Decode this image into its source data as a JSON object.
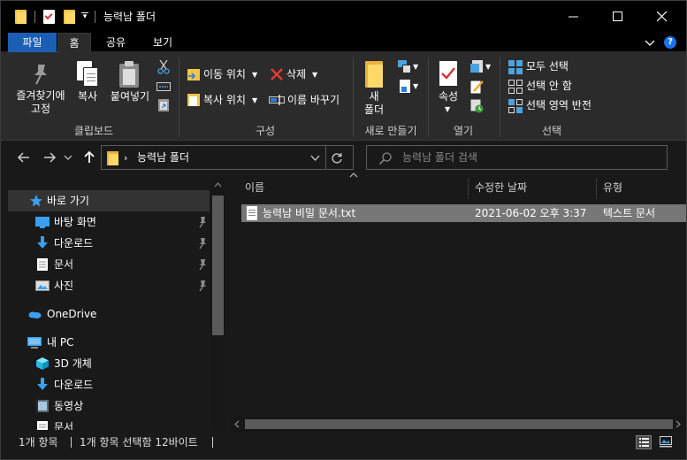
{
  "window": {
    "title": "능력남 폴더"
  },
  "tabs": {
    "file": "파일",
    "home": "홈",
    "share": "공유",
    "view": "보기",
    "help": "?"
  },
  "ribbon": {
    "clipboard": {
      "label": "클립보드",
      "pin_line1": "즐겨찾기에",
      "pin_line2": "고정",
      "copy": "복사",
      "paste": "붙여넣기"
    },
    "organize": {
      "label": "구성",
      "move_to": "이동 위치",
      "copy_to": "복사 위치",
      "delete": "삭제",
      "rename": "이름 바꾸기"
    },
    "new": {
      "label": "새로 만들기",
      "new_folder_line1": "새",
      "new_folder_line2": "폴더"
    },
    "open": {
      "label": "열기",
      "properties": "속성"
    },
    "select": {
      "label": "선택",
      "select_all": "모두 선택",
      "select_none": "선택 안 함",
      "invert": "선택 영역 반전"
    }
  },
  "address": {
    "path": "능력남 폴더",
    "chevron": "›",
    "search_placeholder": "능력남 폴더 검색"
  },
  "navpane": {
    "items": [
      {
        "label": "바로 가기",
        "icon": "star-icon"
      },
      {
        "label": "바탕 화면",
        "icon": "desktop-icon"
      },
      {
        "label": "다운로드",
        "icon": "download-icon"
      },
      {
        "label": "문서",
        "icon": "document-icon"
      },
      {
        "label": "사진",
        "icon": "picture-icon"
      },
      {
        "label": "OneDrive",
        "icon": "cloud-icon"
      },
      {
        "label": "내 PC",
        "icon": "pc-icon"
      },
      {
        "label": "3D 개체",
        "icon": "cube-icon"
      },
      {
        "label": "다운로드",
        "icon": "download-icon"
      },
      {
        "label": "동영상",
        "icon": "video-icon"
      },
      {
        "label": "문서",
        "icon": "document-icon"
      }
    ]
  },
  "filelist": {
    "columns": {
      "name": "이름",
      "modified": "수정한 날짜",
      "type": "유형"
    },
    "rows": [
      {
        "name": "능력남 비밀 문서.txt",
        "modified": "2021-06-02 오후 3:37",
        "type": "텍스트 문서"
      }
    ]
  },
  "status": {
    "count": "1개 항목",
    "selected": "1개 항목 선택함 12바이트"
  },
  "colors": {
    "accent": "#1a5fb4",
    "folder": "#f3c64a",
    "background": "#191919",
    "ribbon": "#2b2b2b",
    "selection": "#777777"
  }
}
